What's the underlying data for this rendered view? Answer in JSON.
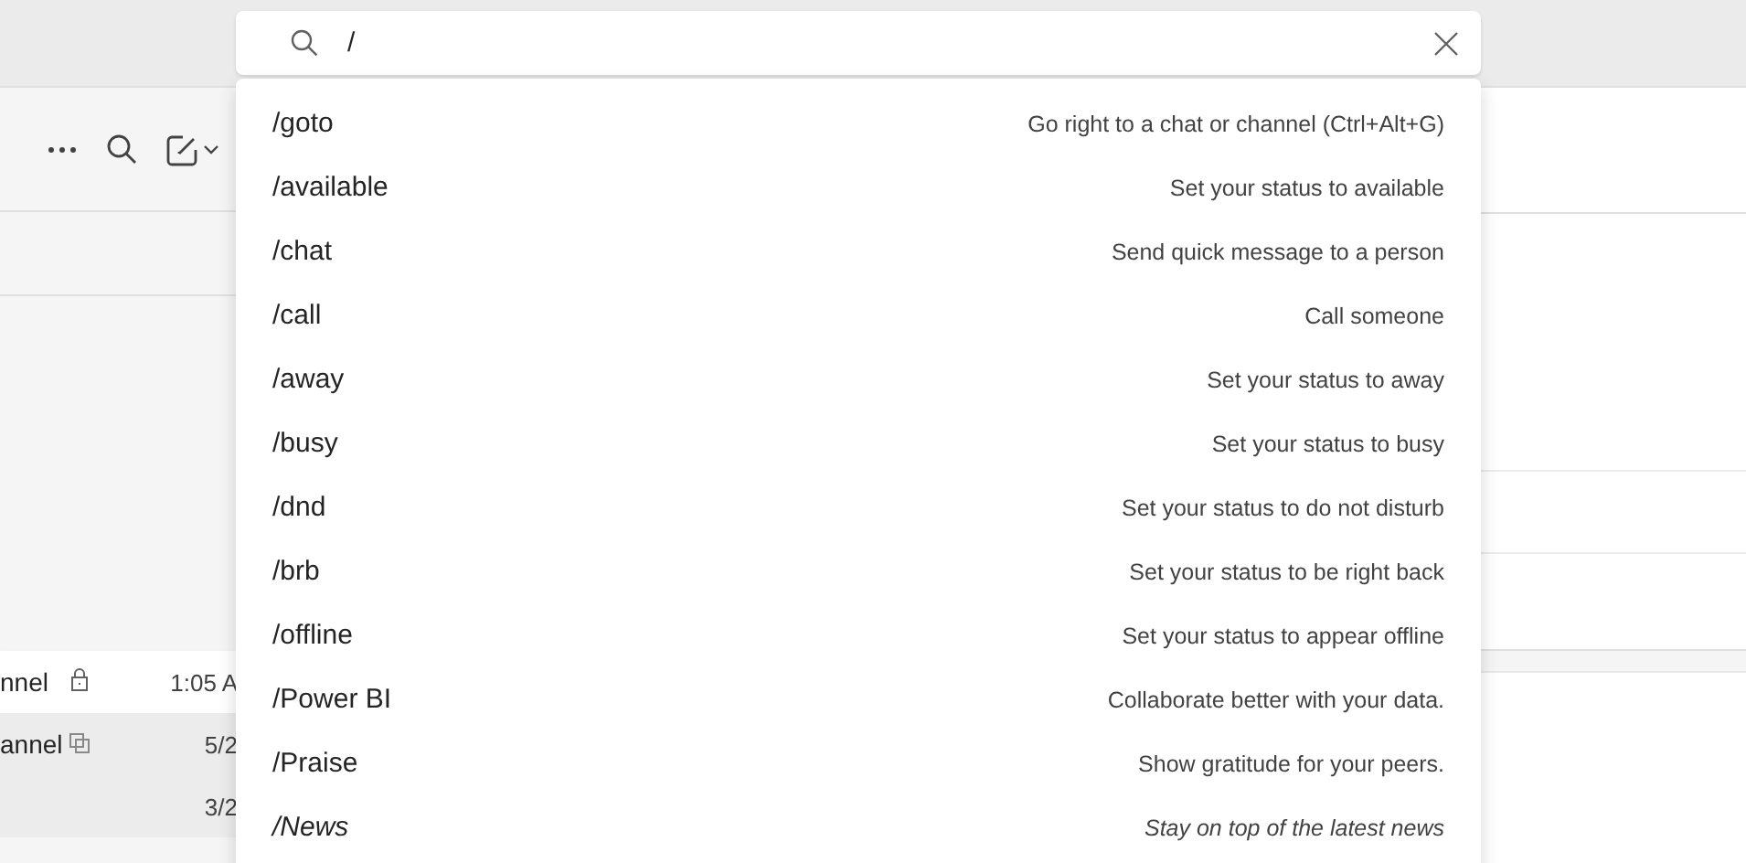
{
  "search": {
    "value": "/"
  },
  "background": {
    "rows": [
      {
        "name": "nnel",
        "kind": "private",
        "time": "1:05 A",
        "selected": true
      },
      {
        "name": "annel",
        "kind": "shared",
        "time": "5/2",
        "selected": false
      },
      {
        "name": "",
        "kind": "plain",
        "time": "3/2",
        "selected": false
      }
    ]
  },
  "commands": [
    {
      "command": "/goto",
      "description": "Go right to a chat or channel (Ctrl+Alt+G)",
      "italic": false
    },
    {
      "command": "/available",
      "description": "Set your status to available",
      "italic": false
    },
    {
      "command": "/chat",
      "description": "Send quick message to a person",
      "italic": false
    },
    {
      "command": "/call",
      "description": "Call someone",
      "italic": false
    },
    {
      "command": "/away",
      "description": "Set your status to away",
      "italic": false
    },
    {
      "command": "/busy",
      "description": "Set your status to busy",
      "italic": false
    },
    {
      "command": "/dnd",
      "description": "Set your status to do not disturb",
      "italic": false
    },
    {
      "command": "/brb",
      "description": "Set your status to be right back",
      "italic": false
    },
    {
      "command": "/offline",
      "description": "Set your status to appear offline",
      "italic": false
    },
    {
      "command": "/Power BI",
      "description": "Collaborate better with your data.",
      "italic": false
    },
    {
      "command": "/Praise",
      "description": "Show gratitude for your peers.",
      "italic": false
    },
    {
      "command": "/News",
      "description": "Stay on top of the latest news",
      "italic": true
    }
  ]
}
